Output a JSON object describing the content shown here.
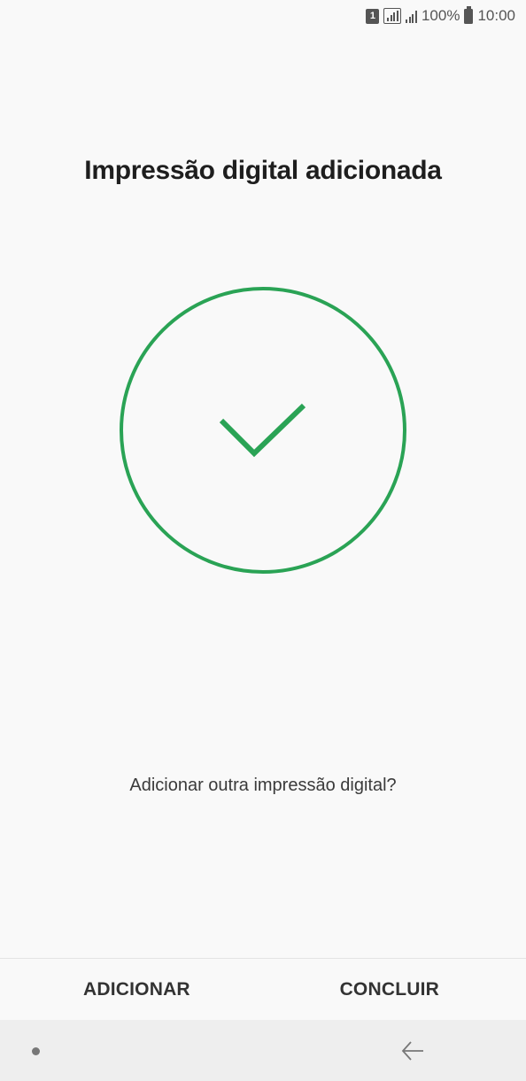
{
  "status_bar": {
    "sim_label": "1",
    "battery": "100%",
    "time": "10:00"
  },
  "title": "Impressão digital adicionada",
  "question": "Adicionar outra impressão digital?",
  "actions": {
    "add_label": "ADICIONAR",
    "done_label": "CONCLUIR"
  },
  "colors": {
    "accent_green": "#2aa355",
    "background": "#f9f9f9",
    "nav_background": "#eeeeee"
  },
  "icons": {
    "success": "check-circle-icon",
    "nav_home": "nav-dot-icon",
    "nav_back": "back-arrow-icon"
  }
}
